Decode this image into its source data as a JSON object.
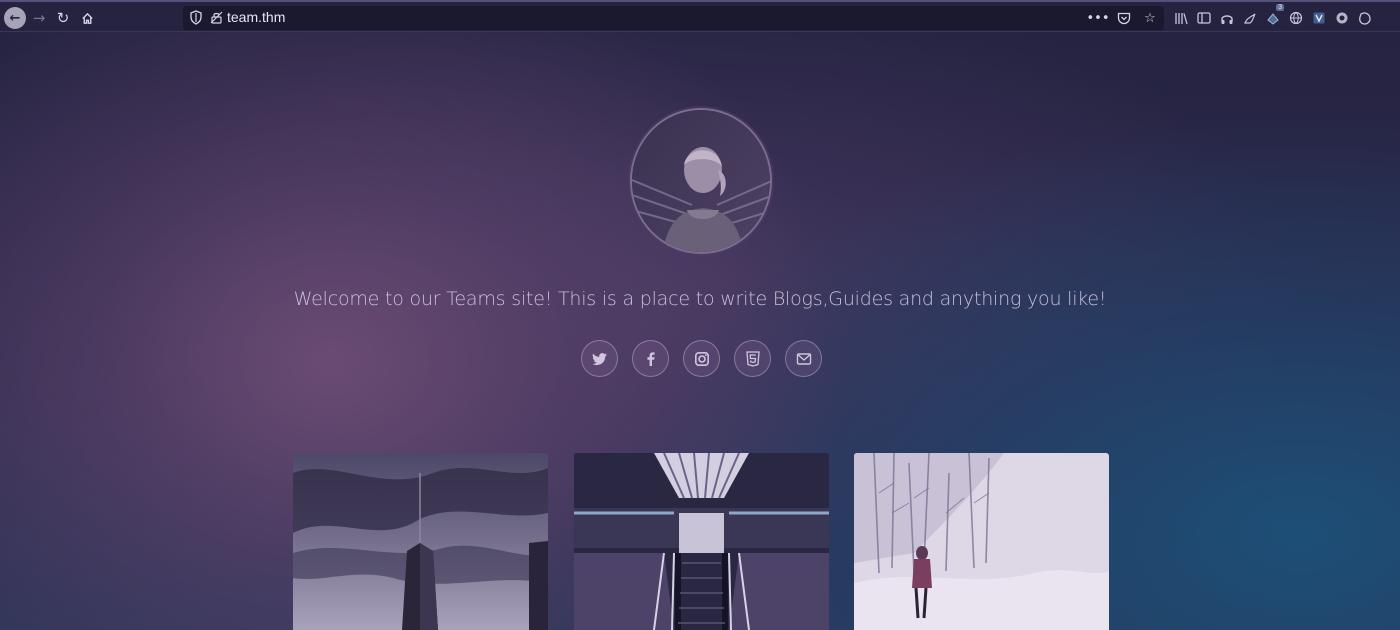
{
  "browser": {
    "url": "team.thm",
    "icons": {
      "back": "arrow-left-icon",
      "forward": "arrow-right-icon",
      "reload": "reload-icon",
      "home": "home-icon",
      "more": "more-icon",
      "pocket": "pocket-icon",
      "bookmark": "star-icon"
    },
    "extension_badge": "3"
  },
  "page": {
    "tagline": "Welcome to our Teams site! This is a place to write Blogs,Guides and anything you like!",
    "social": [
      "twitter-icon",
      "facebook-icon",
      "instagram-icon",
      "html5-icon",
      "envelope-icon"
    ],
    "colors": {
      "background_dark": "#25233f",
      "accent_purple": "#745078",
      "accent_blue": "#1c5078",
      "text": "#c8bfd8"
    }
  }
}
